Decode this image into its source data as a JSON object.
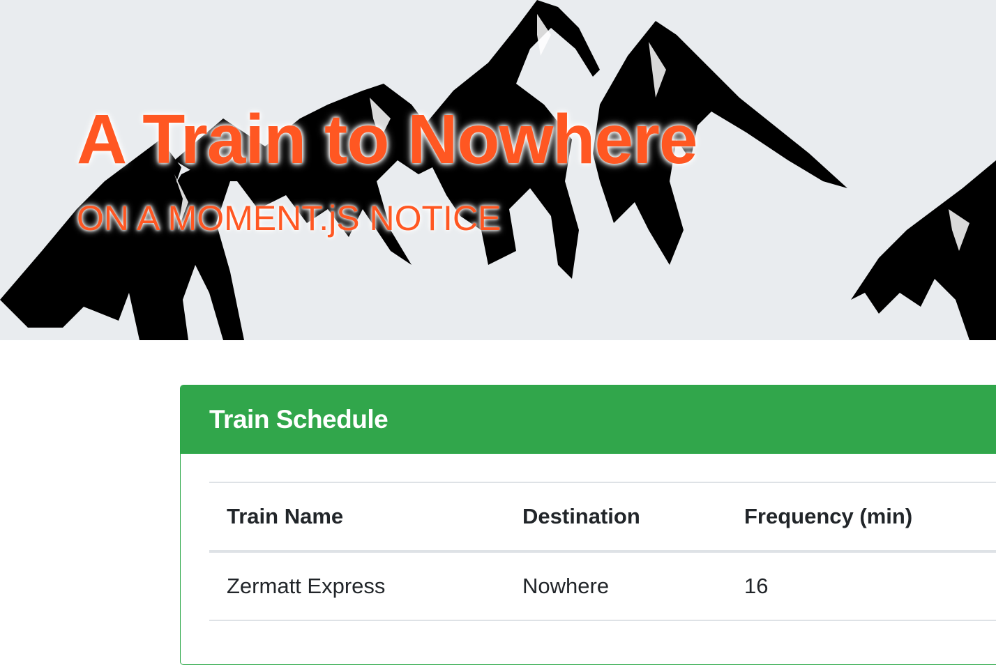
{
  "hero": {
    "title": "A Train to Nowhere",
    "subtitle": "ON A MOMENT.jS NOTICE",
    "background_color": "#e9ecef",
    "title_color": "#ff5722"
  },
  "schedule": {
    "header": "Train Schedule",
    "header_color": "#31a64b",
    "columns": [
      "Train Name",
      "Destination",
      "Frequency (min)"
    ],
    "rows": [
      {
        "name": "Zermatt Express",
        "destination": "Nowhere",
        "frequency": "16"
      }
    ]
  }
}
